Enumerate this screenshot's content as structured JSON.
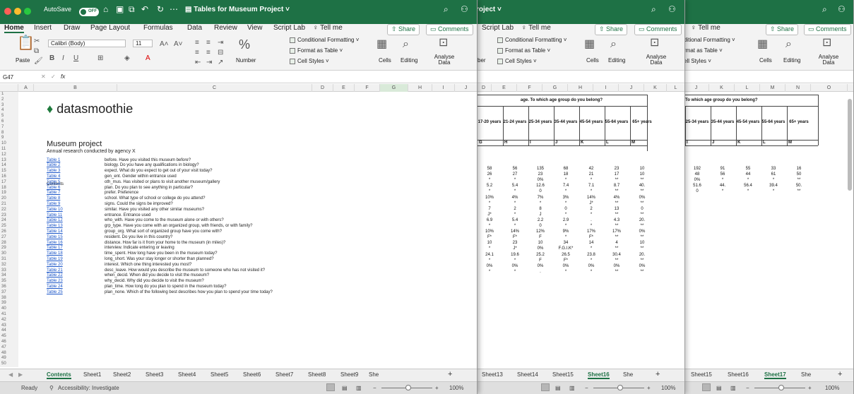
{
  "window": {
    "autosave": "AutoSave",
    "autosave_state": "OFF",
    "title": "Tables for Museum Project",
    "title2": "roject"
  },
  "menu": [
    "Home",
    "Insert",
    "Draw",
    "Page Layout",
    "Formulas",
    "Data",
    "Review",
    "View",
    "Script Lab",
    "Tell me"
  ],
  "menu2": [
    "Script Lab",
    "Tell me"
  ],
  "menu3": [
    "Tell me"
  ],
  "share": "Share",
  "comments": "Comments",
  "ribbon": {
    "paste": "Paste",
    "font_name": "Calibri (Body)",
    "font_size": "11",
    "number": "Number",
    "conditional_formatting": "Conditional Formatting",
    "format_as_table": "Format as Table",
    "cell_styles": "Cell Styles",
    "cells": "Cells",
    "editing": "Editing",
    "analyse_data": "Analyse Data",
    "ber": "ber",
    "w3_cf": "ditional Formatting",
    "w3_ft": "rmat as Table",
    "w3_cs": "ell Styles"
  },
  "formula_bar": {
    "cell_ref": "G47",
    "fx": "fx"
  },
  "columns1": [
    "A",
    "B",
    "C",
    "D",
    "E",
    "F",
    "G",
    "H",
    "I",
    "J"
  ],
  "columns2": [
    "D",
    "E",
    "F",
    "G",
    "H",
    "I",
    "J",
    "K",
    "L"
  ],
  "columns3": [
    "J",
    "K",
    "L",
    "M",
    "N",
    "O"
  ],
  "logo": "datasmoothie",
  "project_title": "Museum project",
  "project_subtitle": "Annual research conducted by agency X",
  "contents_label": "Contents",
  "tables": [
    {
      "link": "Table 1",
      "desc": "before. Have you visited this museum before?"
    },
    {
      "link": "Table 2",
      "desc": "biology. Do you have any qualifications in biology?"
    },
    {
      "link": "Table 3",
      "desc": "expect. What do you expect to get out of your visit today?"
    },
    {
      "link": "Table 4",
      "desc": "gen_ent. Gender within entrance used"
    },
    {
      "link": "Table 5",
      "desc": "oth_mus. Has visited or plans to visit another museum/gallery"
    },
    {
      "link": "Table 6",
      "desc": "plan. Do you plan to see anything in particular?"
    },
    {
      "link": "Table 7",
      "desc": "prefer. Preference"
    },
    {
      "link": "Table 8",
      "desc": "school. What type of school or college do you attend?"
    },
    {
      "link": "Table 9",
      "desc": "signs. Could the signs be improved?"
    },
    {
      "link": "Table 10",
      "desc": "similar. Have you visited any other similar museums?"
    },
    {
      "link": "Table 11",
      "desc": "entrance. Entrance used"
    },
    {
      "link": "Table 12",
      "desc": "who_with. Have you come to the museum alone or with others?"
    },
    {
      "link": "Table 13",
      "desc": "grp_type. Have you come with an organized group, with friends, or with family?"
    },
    {
      "link": "Table 14",
      "desc": "group_org. What sort of organized group have you come with?"
    },
    {
      "link": "Table 15",
      "desc": "resident. Do you live in this country?"
    },
    {
      "link": "Table 16",
      "desc": "distance. How far is it from your home to the museum (in miles)?"
    },
    {
      "link": "Table 17",
      "desc": "interview. Indicate entering or leaving"
    },
    {
      "link": "Table 18",
      "desc": "time_spent. How long have you been in the museum today?"
    },
    {
      "link": "Table 19",
      "desc": "long_short. Was your stay longer or shorter than planned?"
    },
    {
      "link": "Table 20",
      "desc": "interest. Which one thing interested you most?"
    },
    {
      "link": "Table 21",
      "desc": "desc_leave. How would you describe the museum to someone who has not visited it?"
    },
    {
      "link": "Table 22",
      "desc": "when_decid. When did you decide to visit the museum?"
    },
    {
      "link": "Table 23",
      "desc": "why_decid. Why did you decide to visit the museum?"
    },
    {
      "link": "Table 24",
      "desc": "plan_time. How long do you plan to spend in the museum today?"
    },
    {
      "link": "Table 25",
      "desc": "plan_none. Which of the following best describes how you plan to spend your time today?"
    }
  ],
  "sheet_tabs1": [
    "Contents",
    "Sheet1",
    "Sheet2",
    "Sheet3",
    "Sheet4",
    "Sheet5",
    "Sheet6",
    "Sheet7",
    "Sheet8",
    "Sheet9",
    "She"
  ],
  "sheet_tabs2": [
    "Sheet13",
    "Sheet14",
    "Sheet15",
    "Sheet16",
    "She"
  ],
  "sheet_tabs3": [
    "Sheet15",
    "Sheet16",
    "Sheet17",
    "She"
  ],
  "status": {
    "ready": "Ready",
    "accessibility": "Accessibility: Investigate",
    "zoom": "100%"
  },
  "table2": {
    "question": "age. To which age group do you belong?",
    "headers": [
      "17-20 years",
      "21-24 years",
      "25-34 years",
      "35-44 years",
      "45-54 years",
      "55-64 years",
      "65+ years"
    ],
    "letters": [
      "G",
      "H",
      "I",
      "J",
      "K",
      "L",
      "M"
    ],
    "rows": [
      [
        "58",
        "56",
        "135",
        "68",
        "42",
        "23",
        "10"
      ],
      [
        "26",
        "27",
        "23",
        "18",
        "21",
        "17",
        "10"
      ],
      [
        "*",
        "*",
        "0%",
        "*",
        "*",
        "**",
        "**"
      ],
      [
        "5.2",
        "5.4",
        "12.6",
        "7.4",
        "7.1",
        "8.7",
        "40."
      ],
      [
        "*",
        "*",
        "0",
        "*",
        "*",
        "**",
        "**"
      ],
      [
        "10%",
        "4%",
        "7%",
        "3%",
        "14%",
        "4%",
        "0%"
      ],
      [
        "*",
        "*",
        "*",
        "*",
        "J*",
        "**",
        "**"
      ],
      [
        "7",
        "2",
        "8",
        "0",
        "2",
        "13",
        "0"
      ],
      [
        "J*",
        "*",
        "J",
        "*",
        "*",
        "**",
        "**"
      ],
      [
        "6.9",
        "5.4",
        "2.2",
        "2.9",
        ".",
        "4.3",
        "20."
      ],
      [
        "*",
        "*",
        "0",
        "*",
        "*",
        "**",
        "**"
      ],
      [
        "10%",
        "14%",
        "12%",
        "9%",
        "17%",
        "17%",
        "0%"
      ],
      [
        "F*",
        "F*",
        "F",
        "*",
        "F*",
        "**",
        "**"
      ],
      [
        "10",
        "23",
        "10",
        "34",
        "14",
        "4",
        "10"
      ],
      [
        "*",
        "J*",
        "0%",
        "F.G.I.K*",
        "*",
        "**",
        "**"
      ],
      [
        "24.1",
        "19.6",
        "25.2",
        "26.5",
        "23.8",
        "30.4",
        "20."
      ],
      [
        "*",
        "*",
        "F",
        "F*",
        "*",
        "**",
        "**"
      ],
      [
        "0%",
        "0%",
        "0%",
        "0%",
        "0%",
        "0%",
        "0%"
      ],
      [
        "*",
        "*",
        ".",
        "*",
        "*",
        "**",
        "**"
      ]
    ]
  },
  "table3": {
    "question": "To which age group do you belong?",
    "headers": [
      "25-34 years",
      "35-44 years",
      "45-54 years",
      "55-64 years",
      "65+ years"
    ],
    "letters": [
      "I",
      "J",
      "K",
      "L",
      "M"
    ],
    "rows": [
      [
        "192",
        "91",
        "55",
        "33",
        "16"
      ],
      [
        "48",
        "56",
        "44",
        "61",
        "50"
      ],
      [
        "0%",
        "*",
        "*",
        "*",
        "**"
      ],
      [
        "51.6",
        "44.",
        "56.4",
        "39.4",
        "50."
      ],
      [
        "0",
        "*",
        "*",
        "*",
        "**"
      ]
    ]
  }
}
